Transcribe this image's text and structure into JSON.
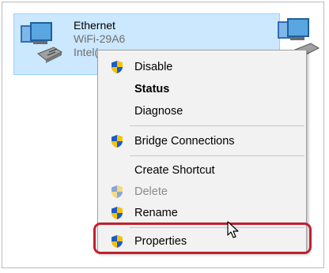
{
  "adapter": {
    "name": "Ethernet",
    "network": "WiFi-29A6",
    "device_partial": "Intel("
  },
  "context_menu": {
    "items": [
      {
        "label": "Disable",
        "icon": "uac-shield-icon",
        "bold": false,
        "enabled": true
      },
      {
        "label": "Status",
        "icon": null,
        "bold": true,
        "enabled": true
      },
      {
        "label": "Diagnose",
        "icon": null,
        "bold": false,
        "enabled": true
      },
      {
        "label": "Bridge Connections",
        "icon": "uac-shield-icon",
        "bold": false,
        "enabled": true
      },
      {
        "label": "Create Shortcut",
        "icon": null,
        "bold": false,
        "enabled": true
      },
      {
        "label": "Delete",
        "icon": "uac-shield-icon",
        "bold": false,
        "enabled": false
      },
      {
        "label": "Rename",
        "icon": "uac-shield-icon",
        "bold": false,
        "enabled": true
      },
      {
        "label": "Properties",
        "icon": "uac-shield-icon",
        "bold": false,
        "enabled": true
      }
    ]
  },
  "colors": {
    "selection_bg": "#cce8ff",
    "highlight_border": "#c0202e",
    "menu_bg": "#f2f2f2"
  }
}
